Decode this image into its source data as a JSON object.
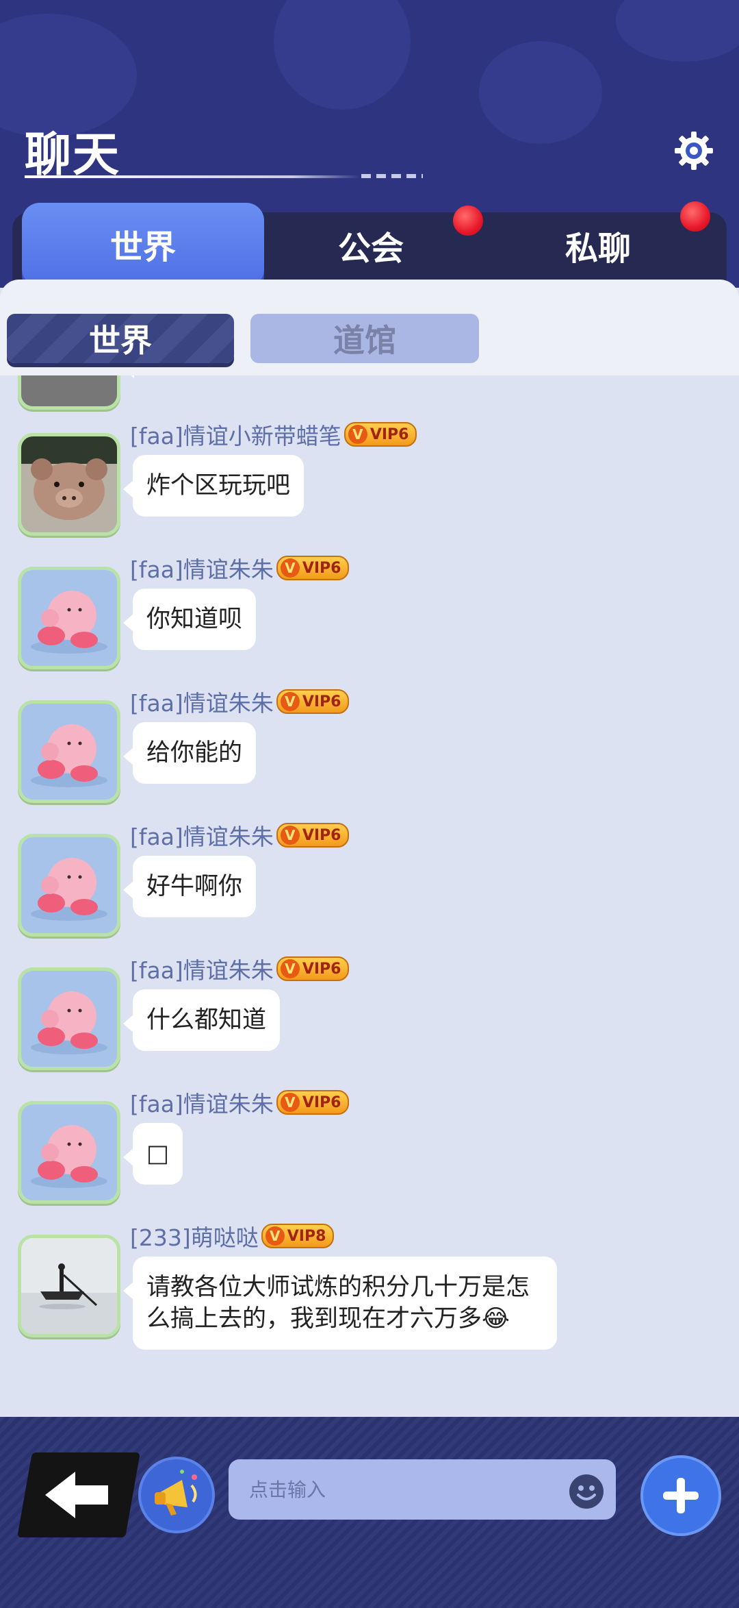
{
  "header": {
    "title": "聊天"
  },
  "main_tabs": [
    {
      "label": "世界",
      "active": true
    },
    {
      "label": "公会",
      "unread_dot": true
    },
    {
      "label": "私聊",
      "unread_dot": true
    }
  ],
  "sub_tabs": [
    {
      "label": "世界",
      "active": true
    },
    {
      "label": "道馆",
      "active": false
    }
  ],
  "messages": [
    {
      "sender": "[faa]情谊小新带蜡笔",
      "vip": "VIP6",
      "text": "炸个区玩玩吧",
      "avatar": "teddy-pig-avatar"
    },
    {
      "sender": "[faa]情谊朱朱",
      "vip": "VIP6",
      "text": "你知道呗",
      "avatar": "kirby-avatar"
    },
    {
      "sender": "[faa]情谊朱朱",
      "vip": "VIP6",
      "text": "给你能的",
      "avatar": "kirby-avatar"
    },
    {
      "sender": "[faa]情谊朱朱",
      "vip": "VIP6",
      "text": "好牛啊你",
      "avatar": "kirby-avatar"
    },
    {
      "sender": "[faa]情谊朱朱",
      "vip": "VIP6",
      "text": "什么都知道",
      "avatar": "kirby-avatar"
    },
    {
      "sender": "[faa]情谊朱朱",
      "vip": "VIP6",
      "text": "□",
      "avatar": "kirby-avatar"
    },
    {
      "sender": "[233]萌哒哒",
      "vip": "VIP8",
      "text": "请教各位大师试炼的积分几十万是怎么搞上去的，我到现在才六万多😂",
      "avatar": "boat-avatar"
    }
  ],
  "input": {
    "placeholder": "点击输入"
  },
  "colors": {
    "header_bg": "#2e3480",
    "active_tab": "#5a7eec",
    "chat_bg": "#dde2f2",
    "unread_dot": "#e8182a",
    "vip_badge": "#f5b52e"
  }
}
